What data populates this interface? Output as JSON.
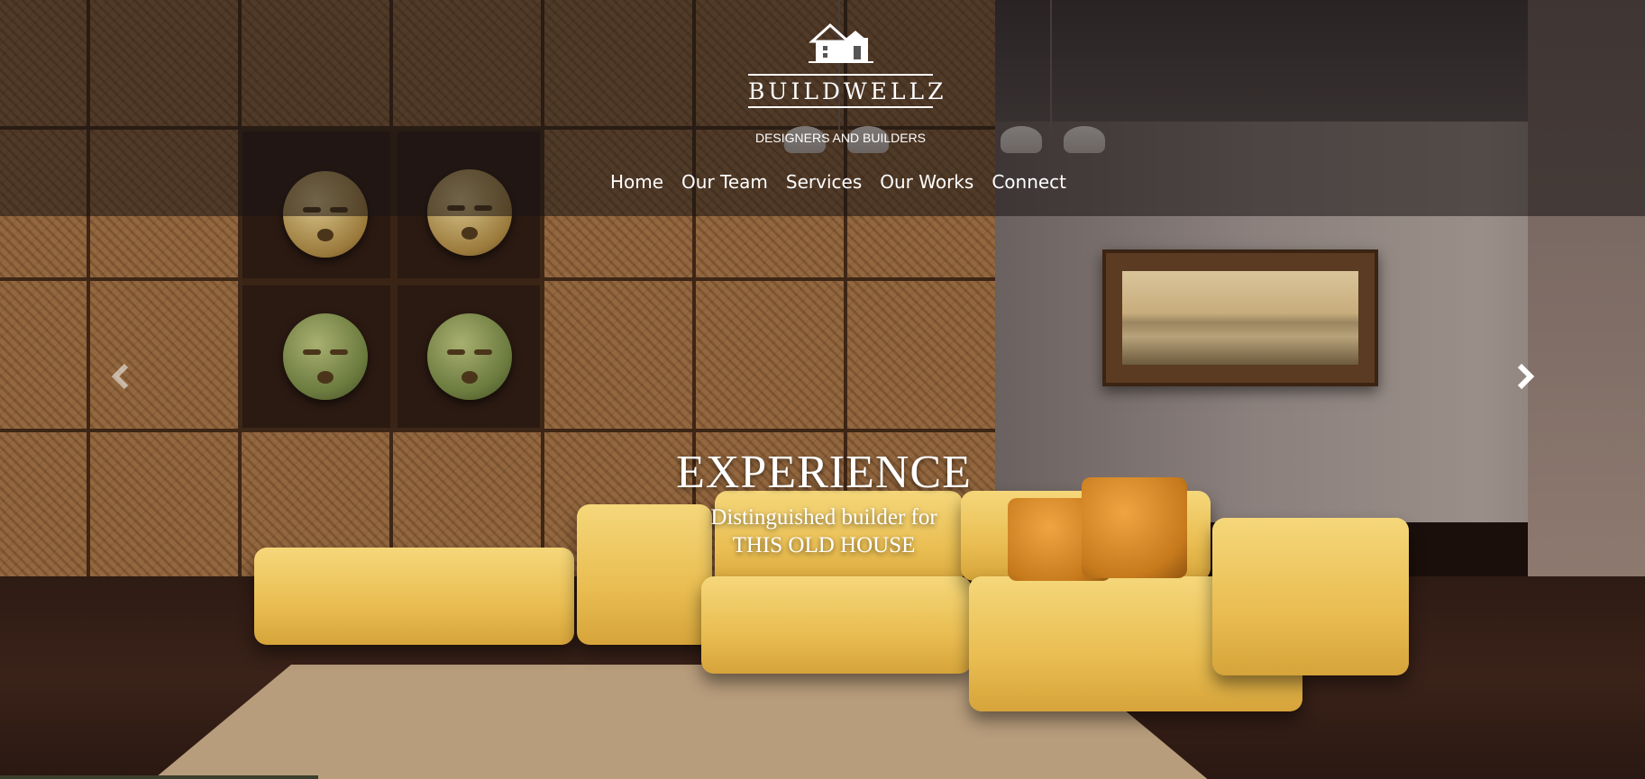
{
  "brand": {
    "name": "BUILDWELLZ",
    "tagline": "DESIGNERS AND BUILDERS",
    "logo_icon": "house-logo-icon"
  },
  "nav": {
    "items": [
      {
        "label": "Home"
      },
      {
        "label": "Our Team"
      },
      {
        "label": "Services"
      },
      {
        "label": "Our Works"
      },
      {
        "label": "Connect"
      }
    ]
  },
  "carousel": {
    "title": "EXPERIENCE",
    "subtitle_line1": "Distinguished builder for",
    "subtitle_line2": "THIS OLD HOUSE",
    "prev_icon": "chevron-left-icon",
    "next_icon": "chevron-right-icon"
  },
  "colors": {
    "header_overlay": "rgba(25,20,20,0.55)",
    "text": "#ffffff",
    "sofa": "#e9bd51",
    "wood": "#8c6038"
  }
}
